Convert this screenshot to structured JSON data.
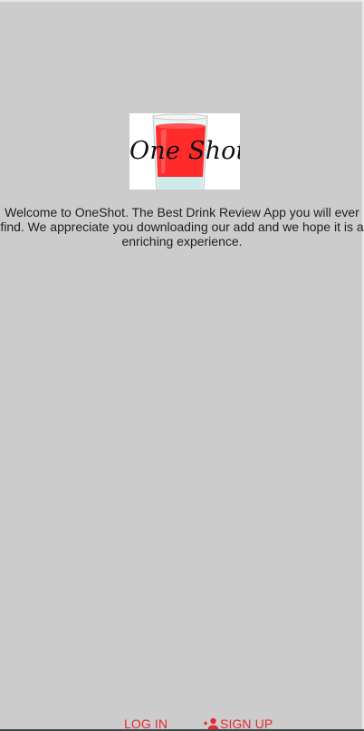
{
  "logo": {
    "text": "One Shot",
    "icon": "shot-glass-icon",
    "colors": {
      "drink": "#ff2a2a",
      "glass": "#d9f0f0"
    }
  },
  "welcome": {
    "message": "Welcome to OneShot. The Best Drink Review App you will ever find. We appreciate you downloading our add and we hope it is a enriching experience."
  },
  "nav": {
    "login_label": "LOG IN",
    "signup_label": "SIGN UP",
    "signup_icon": "add-user-icon",
    "accent_color": "#e52a33"
  },
  "theme": {
    "background": "#cccccc"
  }
}
